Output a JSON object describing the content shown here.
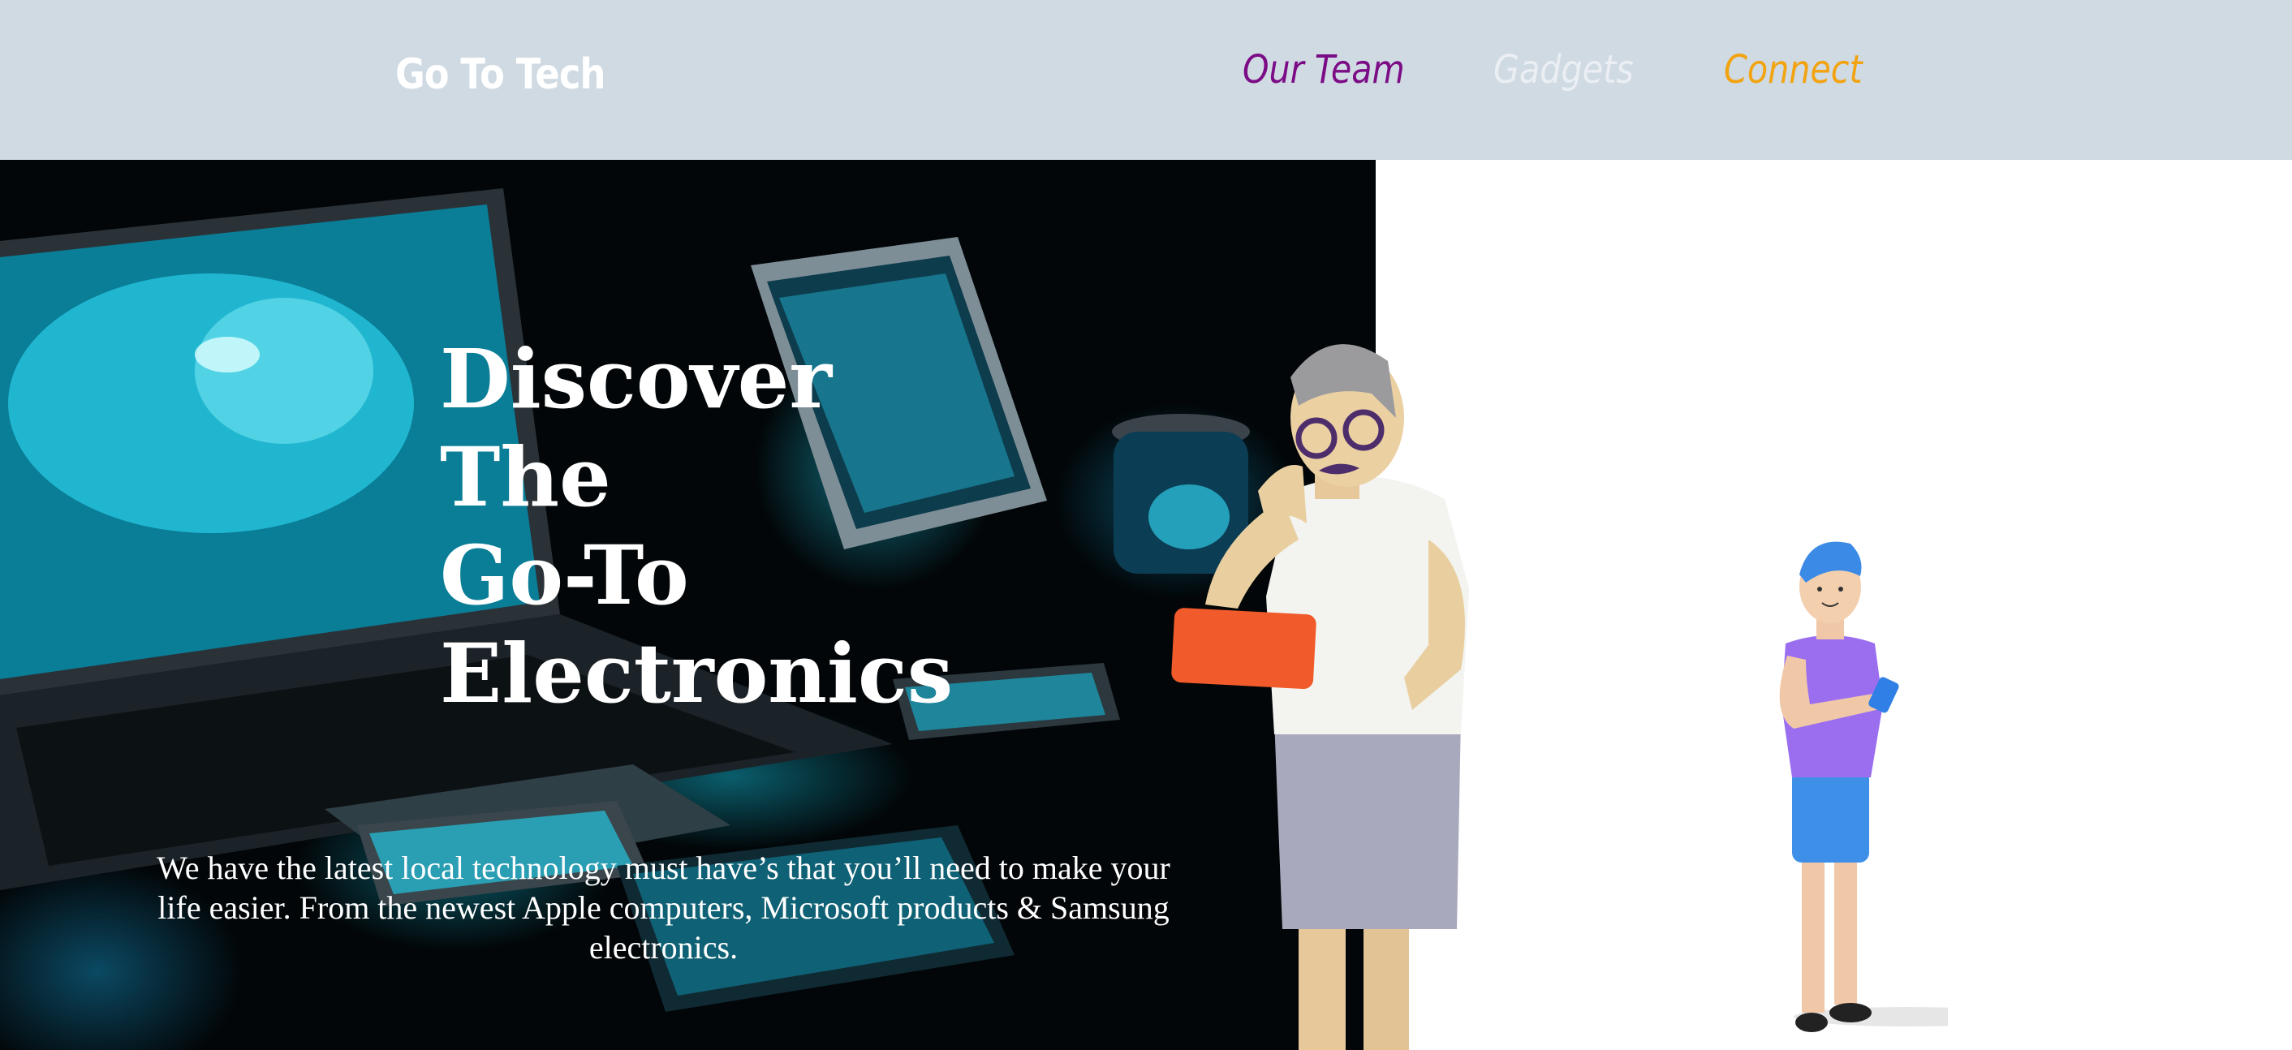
{
  "header": {
    "brand": "Go To Tech",
    "nav": [
      {
        "label": "Our Team",
        "color": "#7b0c86"
      },
      {
        "label": "Gadgets",
        "color": "#ebeff3"
      },
      {
        "label": "Connect",
        "color": "#f2a30f"
      }
    ],
    "background": "#d0dae3"
  },
  "hero": {
    "title_lines": [
      "Discover",
      "The",
      "Go-To",
      "Electronics"
    ],
    "description": "We have the latest local technology must have’s that you’ll need to make your life easier. From the newest Apple computers, Microsoft products & Samsung electronics.",
    "background_image": "glowing-devices-image",
    "figure_left": "thinking-man-with-tablet-illustration",
    "figure_right": "boy-with-phone-illustration"
  }
}
